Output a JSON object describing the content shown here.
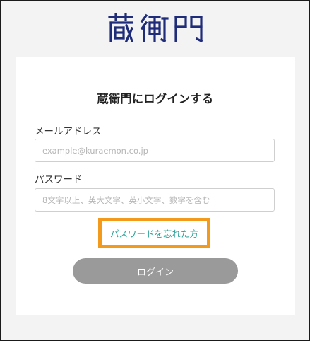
{
  "brand": {
    "logo_text": "蔵衛門",
    "color": "#1f2c7a"
  },
  "login_card": {
    "title": "蔵衛門にログインする",
    "email_label": "メールアドレス",
    "email_placeholder": "example@kuraemon.co.jp",
    "email_value": "",
    "password_label": "パスワード",
    "password_placeholder": "8文字以上、英大文字、英小文字、数字を含む",
    "password_value": "",
    "forgot_password_link": "パスワードを忘れた方",
    "login_button": "ログイン"
  },
  "colors": {
    "highlight_border": "#f39a1d",
    "link": "#2ba39a",
    "button_disabled": "#9a9a9a"
  }
}
